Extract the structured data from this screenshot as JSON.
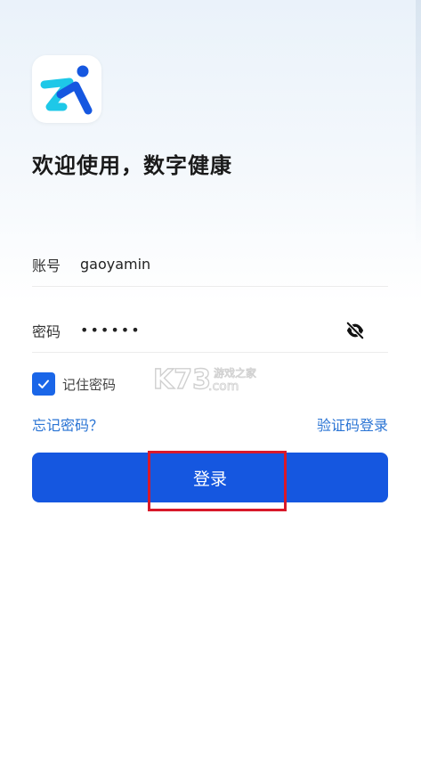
{
  "app": {
    "title": "欢迎使用，数字健康",
    "logo_icon": "sports-runner-logo-icon",
    "brand_color": "#1557e0",
    "logo_accent": "#1ec8e8"
  },
  "form": {
    "account_label": "账号",
    "account_value": "gaoyamin",
    "password_label": "密码",
    "password_masked": "••••••",
    "visibility_icon": "eye-off-icon",
    "remember_label": "记住密码",
    "remember_checked": true
  },
  "links": {
    "forgot_password": "忘记密码？",
    "sms_login": "验证码登录"
  },
  "actions": {
    "login_label": "登录"
  },
  "watermark": {
    "brand": "K73",
    "tagline": "游戏之家",
    "domain": ".com"
  }
}
